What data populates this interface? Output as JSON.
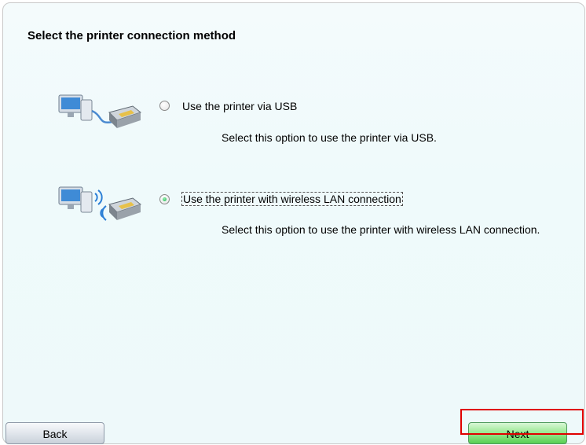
{
  "page": {
    "title": "Select the printer connection method"
  },
  "options": [
    {
      "icon": "computer-usb-printer-icon",
      "label": "Use the printer via USB",
      "description": "Select this option to use the printer via USB.",
      "selected": false
    },
    {
      "icon": "computer-wireless-printer-icon",
      "label": "Use the printer with wireless LAN connection",
      "description": "Select this option to use the printer with wireless LAN connection.",
      "selected": true
    }
  ],
  "buttons": {
    "back_label": "Back",
    "next_label": "Next"
  },
  "colors": {
    "highlight": "#e00000",
    "next_button": "#58cf52",
    "selected_radio": "#2fbf5e"
  }
}
